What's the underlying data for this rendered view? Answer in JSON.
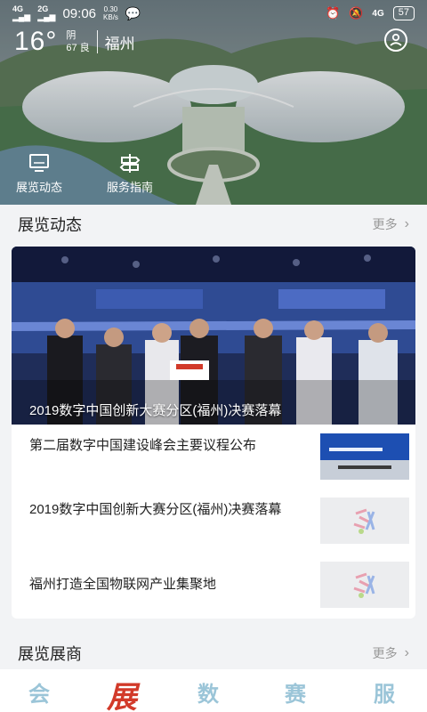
{
  "status_bar": {
    "net_left": "4G",
    "net_left2": "2G",
    "time": "09:06",
    "speed_value": "0.30",
    "speed_unit": "KB/s",
    "net_right": "4G",
    "battery": "57"
  },
  "weather": {
    "temp": "16°",
    "condition": "阴",
    "aqi": "67 良",
    "city": "福州"
  },
  "quick_actions": [
    {
      "label": "展览动态",
      "icon": "monitor-icon"
    },
    {
      "label": "服务指南",
      "icon": "guide-icon"
    }
  ],
  "news_section": {
    "title": "展览动态",
    "more": "更多"
  },
  "featured": {
    "caption": "2019数字中国创新大赛分区(福州)决赛落幕"
  },
  "news_items": [
    {
      "title": "第二届数字中国建设峰会主要议程公布",
      "thumb": "press-conference"
    },
    {
      "title": "2019数字中国创新大赛分区(福州)决赛落幕",
      "thumb": "logo"
    },
    {
      "title": "福州打造全国物联网产业集聚地",
      "thumb": "logo"
    }
  ],
  "exhibitors_section": {
    "title": "展览展商",
    "more": "更多"
  },
  "bottom_tabs": [
    "会",
    "展",
    "数",
    "赛",
    "服"
  ],
  "colors": {
    "active_tab": "#d23a2a",
    "inactive_tab": "#9bc5d8"
  }
}
